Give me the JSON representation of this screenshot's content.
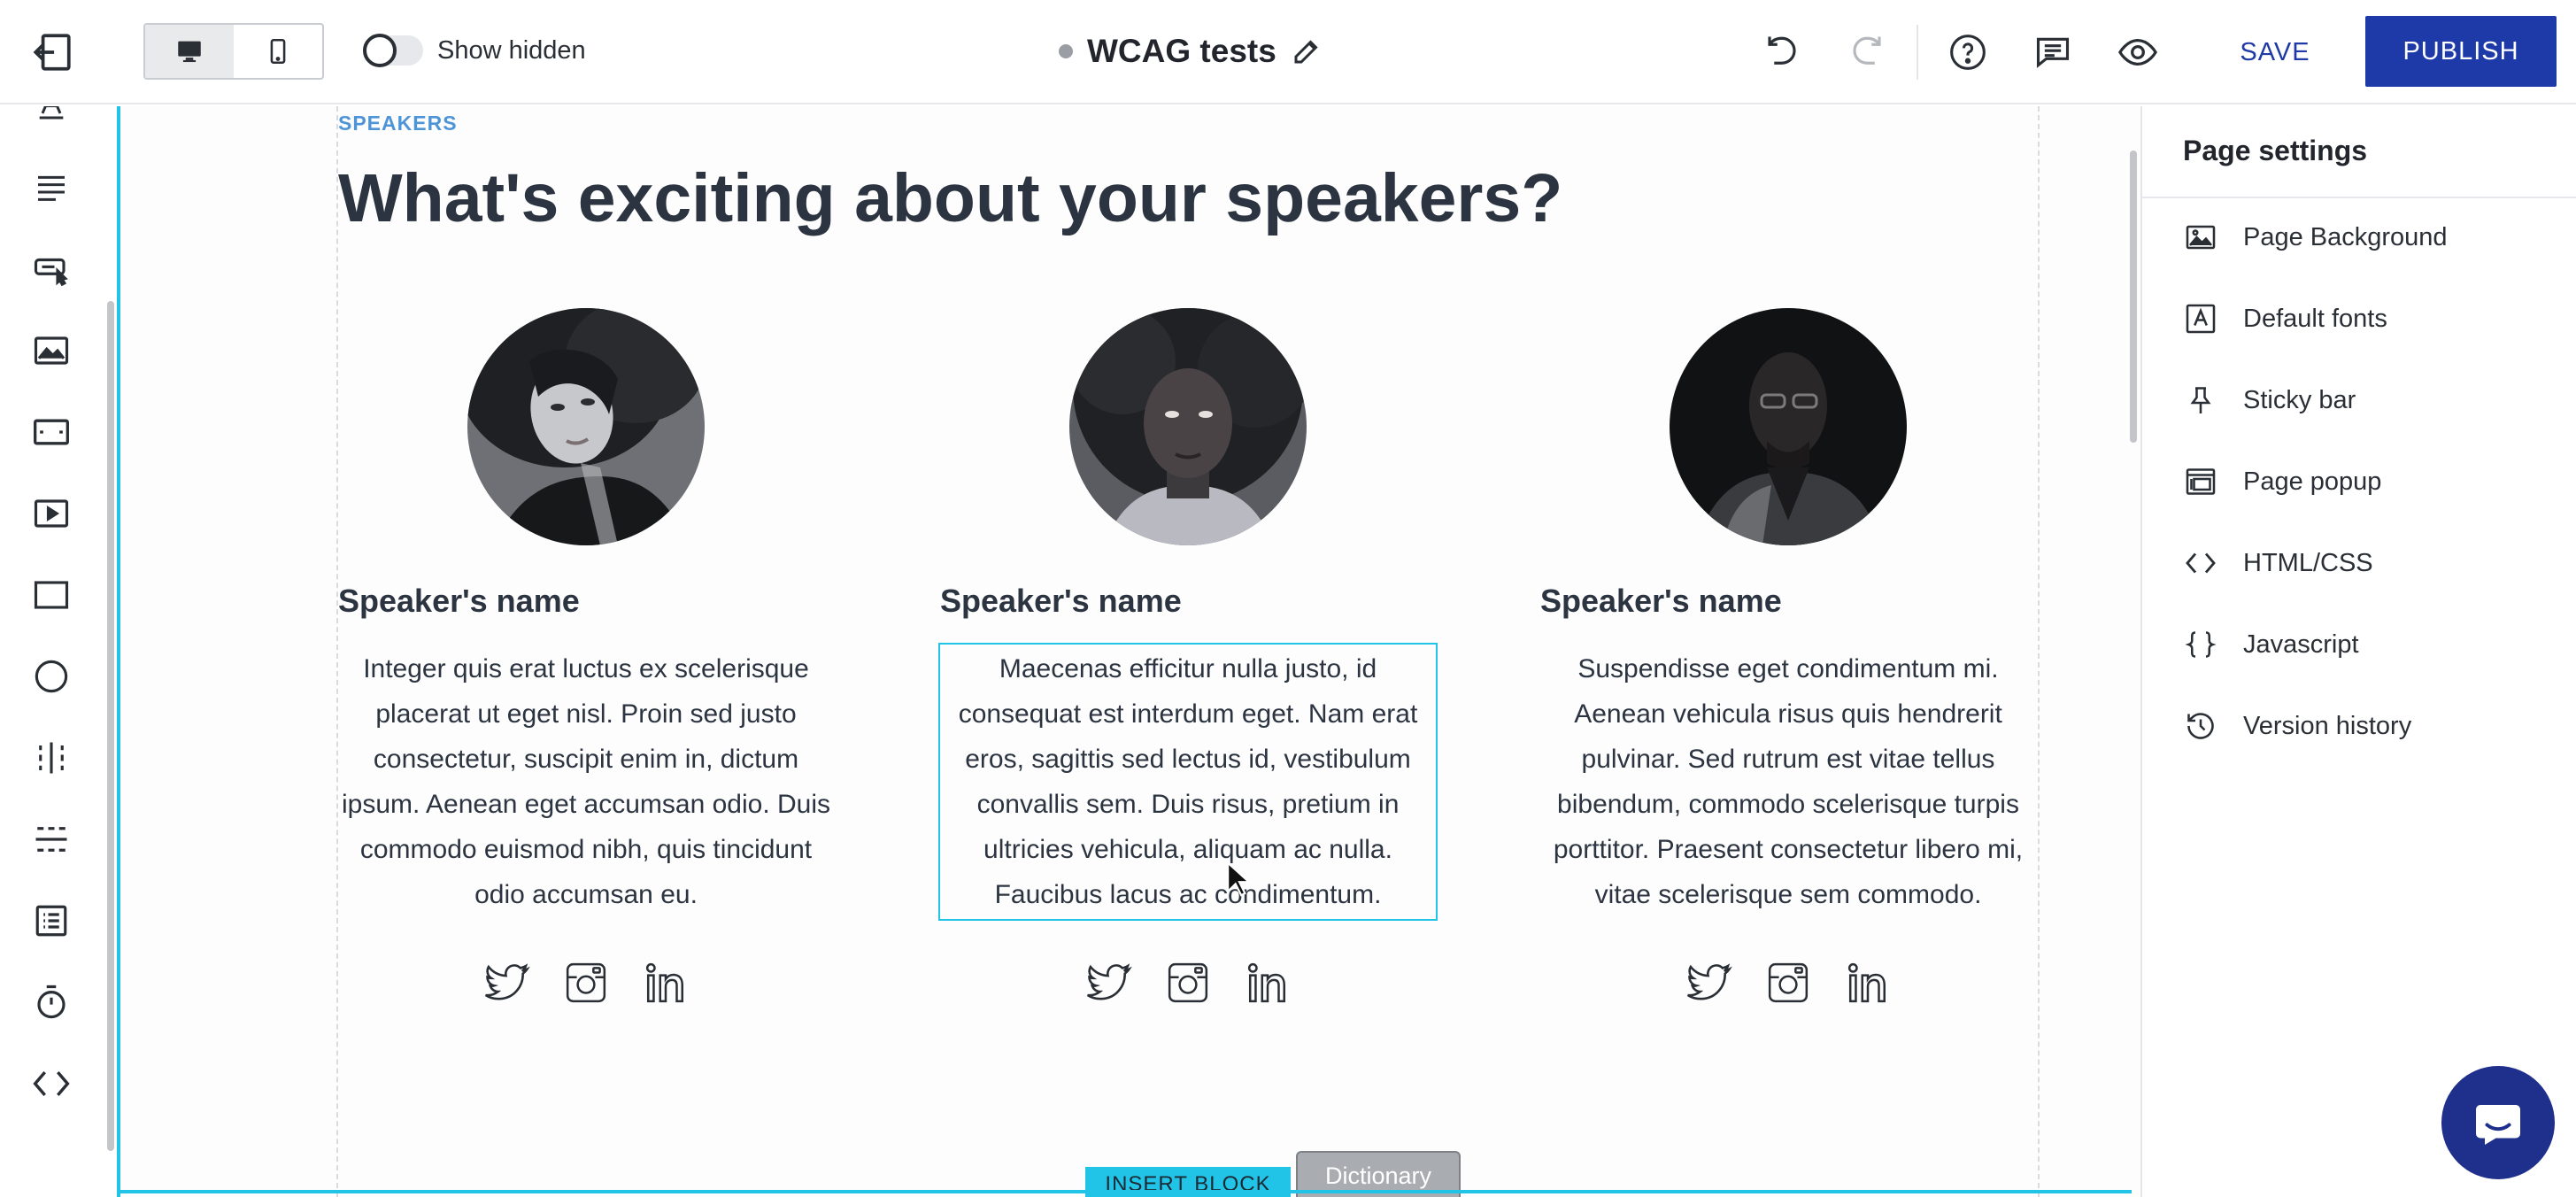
{
  "topbar": {
    "show_hidden_label": "Show hidden",
    "title": "WCAG tests",
    "save_label": "SAVE",
    "publish_label": "PUBLISH"
  },
  "section": {
    "label": "SPEAKERS",
    "heading": "What's exciting about your speakers?"
  },
  "speakers": [
    {
      "name": "Speaker's name",
      "bio": "Integer quis erat luctus ex scelerisque placerat ut eget nisl. Proin sed justo consectetur, suscipit enim in, dictum ipsum. Aenean eget accumsan odio. Duis commodo euismod nibh, quis tincidunt odio accumsan eu."
    },
    {
      "name": "Speaker's name",
      "bio": "Maecenas efficitur nulla justo, id consequat est interdum eget. Nam erat eros, sagittis sed lectus id, vestibulum convallis sem. Duis risus, pretium in ultricies vehicula, aliquam ac nulla. Faucibus lacus ac condimentum."
    },
    {
      "name": "Speaker's name",
      "bio": "Suspendisse eget condimentum mi. Aenean vehicula risus quis hendrerit pulvinar. Sed rutrum est vitae tellus bibendum, commodo scelerisque turpis porttitor. Praesent consectetur libero mi, vitae scelerisque sem commodo."
    }
  ],
  "canvas": {
    "insert_block_label": "INSERT BLOCK",
    "dictionary_label": "Dictionary"
  },
  "panel": {
    "title": "Page settings",
    "items": [
      {
        "label": "Page Background",
        "icon": "image-icon"
      },
      {
        "label": "Default fonts",
        "icon": "font-icon"
      },
      {
        "label": "Sticky bar",
        "icon": "pin-icon"
      },
      {
        "label": "Page popup",
        "icon": "popup-icon"
      },
      {
        "label": "HTML/CSS",
        "icon": "code-icon"
      },
      {
        "label": "Javascript",
        "icon": "braces-icon"
      },
      {
        "label": "Version history",
        "icon": "history-icon"
      }
    ]
  },
  "colors": {
    "accent": "#1e3aa8",
    "selection": "#21c4e6",
    "section_label": "#4e95d8",
    "text": "#2b3440"
  }
}
